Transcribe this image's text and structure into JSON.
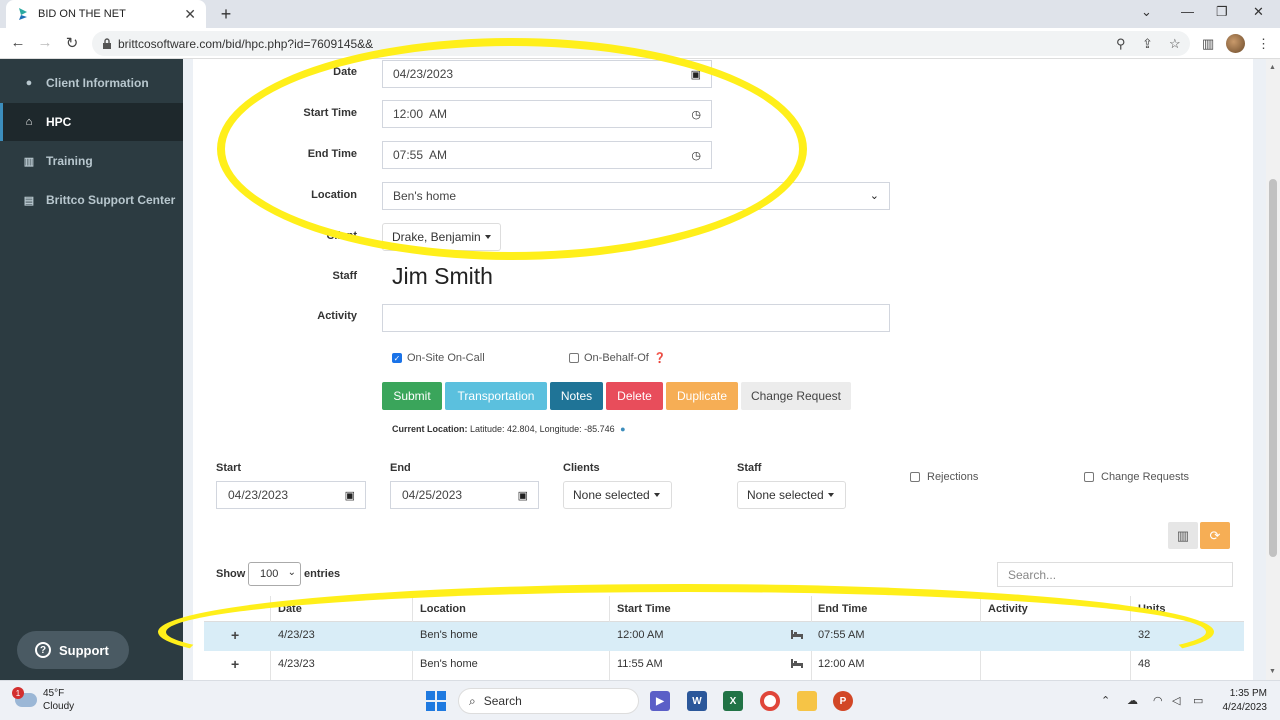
{
  "browser": {
    "tab_title": "BID ON THE NET",
    "url_host": "brittcosoftware.com",
    "url_path": "/bid/hpc.php?id=7609145&&"
  },
  "sidebar": {
    "items": [
      {
        "label": "Client Information",
        "icon": "user-icon"
      },
      {
        "label": "HPC",
        "icon": "home-icon"
      },
      {
        "label": "Training",
        "icon": "building-icon"
      },
      {
        "label": "Brittco Support Center",
        "icon": "book-icon"
      }
    ],
    "support_label": "Support"
  },
  "form": {
    "date_label": "Date",
    "date_value": "04/23/2023",
    "start_time_label": "Start Time",
    "start_time_value": "12:00  AM",
    "end_time_label": "End Time",
    "end_time_value": "07:55  AM",
    "location_label": "Location",
    "location_value": "Ben's home",
    "client_label": "Client",
    "client_value": "Drake, Benjamin",
    "staff_label": "Staff",
    "staff_value": "Jim Smith",
    "activity_label": "Activity",
    "activity_value": "",
    "onsite_label": "On-Site On-Call",
    "onsite_checked": true,
    "onbehalf_label": "On-Behalf-Of",
    "onbehalf_checked": false
  },
  "buttons": {
    "submit": "Submit",
    "transportation": "Transportation",
    "notes": "Notes",
    "delete": "Delete",
    "duplicate": "Duplicate",
    "change_request": "Change Request"
  },
  "current_location": {
    "label": "Current Location:",
    "value": "Latitude: 42.804, Longitude: -85.746"
  },
  "filters": {
    "start_label": "Start",
    "start_value": "04/23/2023",
    "end_label": "End",
    "end_value": "04/25/2023",
    "clients_label": "Clients",
    "clients_value": "None selected",
    "staff_label": "Staff",
    "staff_value": "None selected",
    "rejections_label": "Rejections",
    "change_requests_label": "Change Requests"
  },
  "table_controls": {
    "show_label": "Show",
    "entries_value": "100",
    "entries_label": "entries",
    "search_placeholder": "Search..."
  },
  "table": {
    "columns": [
      "Date",
      "Location",
      "Start Time",
      "End Time",
      "Activity",
      "Units"
    ],
    "rows": [
      {
        "date": "4/23/23",
        "location": "Ben's home",
        "start": "12:00 AM",
        "end": "07:55 AM",
        "activity": "",
        "units": "32"
      },
      {
        "date": "4/23/23",
        "location": "Ben's home",
        "start": "11:55 AM",
        "end": "12:00 AM",
        "activity": "",
        "units": "48"
      }
    ]
  },
  "taskbar": {
    "temp": "45°F",
    "weather": "Cloudy",
    "weather_badge": "1",
    "search_label": "Search",
    "time": "1:35 PM",
    "date": "4/24/2023"
  },
  "colors": {
    "sidebar_bg": "#2c3b41",
    "submit": "#3aa55b",
    "transportation": "#5bc0de",
    "notes": "#1f7497",
    "delete": "#e84d5b",
    "duplicate": "#f6ae55",
    "change_request": "#ececec",
    "annotation": "#ffef1a"
  }
}
